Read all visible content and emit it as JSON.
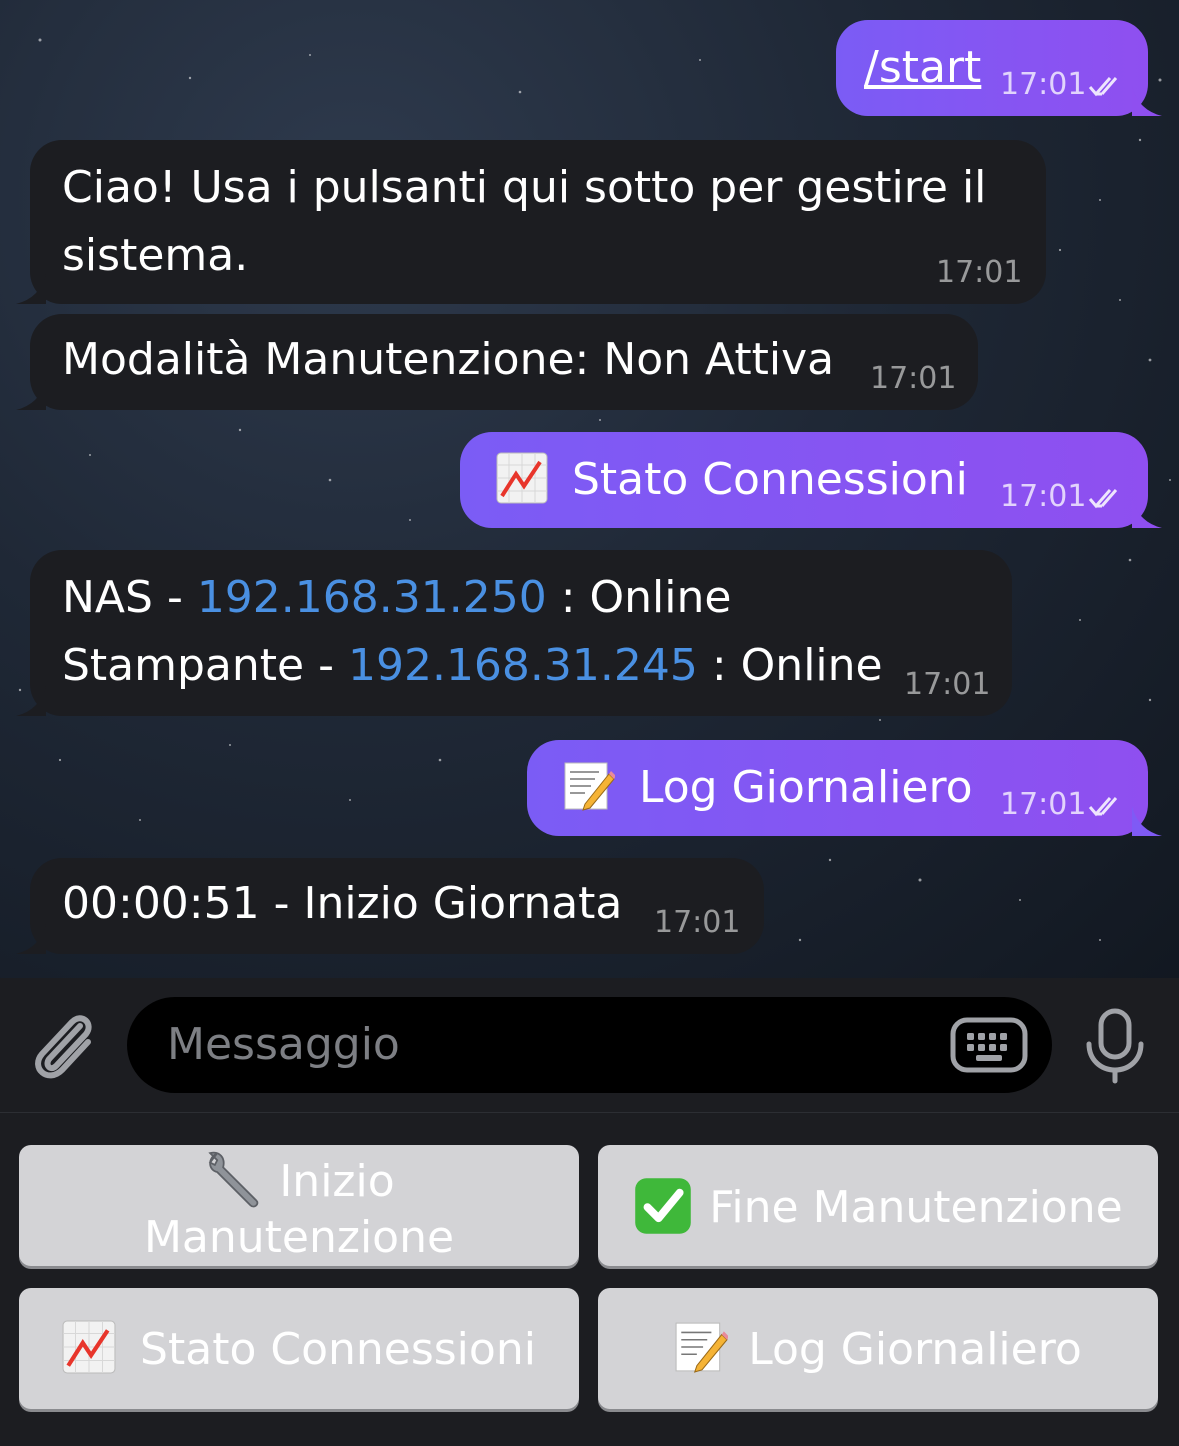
{
  "messages": [
    {
      "direction": "out",
      "text": "/start",
      "time": "17:01",
      "read": true
    },
    {
      "direction": "in",
      "lines": [
        "Ciao! Usa i pulsanti qui sotto per gestire il",
        "sistema."
      ],
      "time": "17:01"
    },
    {
      "direction": "in",
      "text": "Modalità Manutenzione: Non Attiva",
      "time": "17:01"
    },
    {
      "direction": "out",
      "emoji": "chart-increasing-icon",
      "text": "Stato Connessioni",
      "time": "17:01",
      "read": true
    },
    {
      "direction": "in",
      "devices": [
        {
          "name": "NAS",
          "sep": " - ",
          "ip": "192.168.31.250",
          "status": " : Online"
        },
        {
          "name": "Stampante",
          "sep": " - ",
          "ip": "192.168.31.245",
          "status": " : Online"
        }
      ],
      "time": "17:01"
    },
    {
      "direction": "out",
      "emoji": "memo-icon",
      "text": "Log Giornaliero",
      "time": "17:01",
      "read": true
    },
    {
      "direction": "in",
      "text": "00:00:51 - Inizio Giornata",
      "time": "17:01"
    }
  ],
  "composer": {
    "placeholder": "Messaggio"
  },
  "keyboard": {
    "buttons": [
      {
        "icon": "wrench-icon",
        "lines": [
          "Inizio",
          "Manutenzione"
        ]
      },
      {
        "icon": "check-mark-button-icon",
        "label": "Fine Manutenzione"
      },
      {
        "icon": "chart-increasing-icon",
        "label": "Stato Connessioni"
      },
      {
        "icon": "memo-icon",
        "label": "Log Giornaliero"
      }
    ]
  },
  "colors": {
    "outgoing": "#8a55f2",
    "incoming": "#1c1d21",
    "link": "#4a90e2",
    "button": "#d3d3d6"
  }
}
